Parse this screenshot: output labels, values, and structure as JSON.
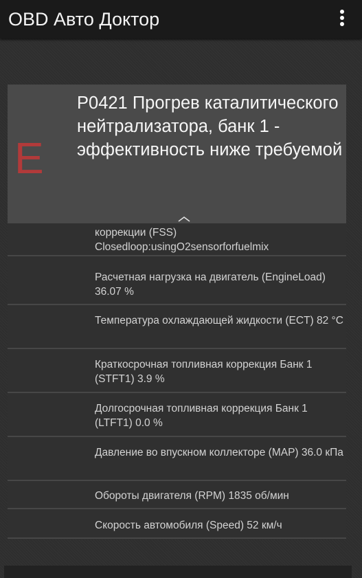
{
  "app": {
    "title": "OBD Авто Доктор",
    "menu_icon": "more-vert-icon"
  },
  "dtc": {
    "severity": "E",
    "severity_color": "#b23a3a",
    "title": "P0421  Прогрев каталитического нейтрализатора, банк 1 - эффективность ниже требуемой",
    "collapse_icon": "chevron-up-icon"
  },
  "params": [
    {
      "text": "коррекции (FSS) Closedloop:usingO2sensorforfuelmix"
    },
    {
      "text": "Расчетная нагрузка на двигатель (EngineLoad) 36.07 %"
    },
    {
      "text": "Температура охлаждающей жидкости (ECT) 82 °C"
    },
    {
      "text": "Краткосрочная топливная коррекция Банк 1 (STFT1) 3.9 %"
    },
    {
      "text": "Долгосрочная топливная коррекция Банк 1 (LTFT1) 0.0 %"
    },
    {
      "text": "Давление во впускном коллекторе (MAP) 36.0 кПа"
    },
    {
      "text": "Обороты двигателя (RPM) 1835 об/мин"
    },
    {
      "text": "Скорость автомобиля (Speed) 52 км/ч"
    }
  ]
}
